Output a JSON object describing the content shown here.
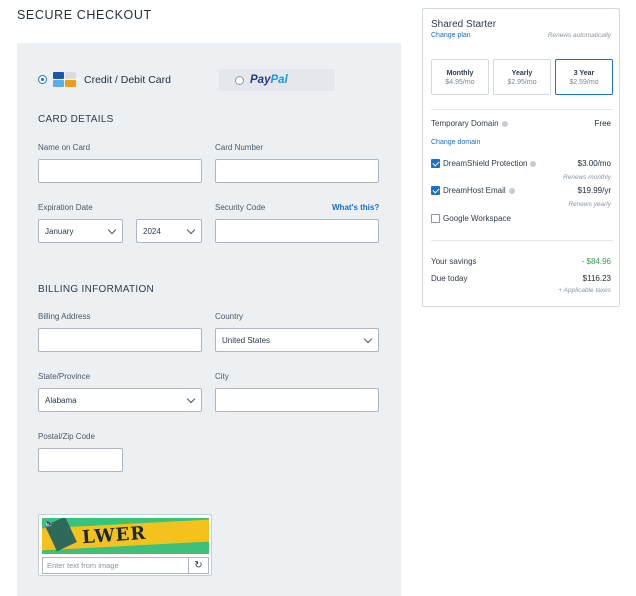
{
  "page": {
    "title": "SECURE CHECKOUT"
  },
  "payment": {
    "credit_label": "Credit / Debit Card",
    "paypal_pay": "Pay",
    "paypal_pal": "Pal",
    "selected": "credit"
  },
  "card_details": {
    "heading": "CARD DETAILS",
    "name_label": "Name on Card",
    "name_value": "",
    "number_label": "Card Number",
    "number_value": "",
    "expiration_label": "Expiration Date",
    "month_value": "January",
    "year_value": "2024",
    "security_label": "Security Code",
    "whats_this": "What's this?",
    "security_value": ""
  },
  "billing": {
    "heading": "BILLING INFORMATION",
    "address_label": "Billing Address",
    "address_value": "",
    "country_label": "Country",
    "country_value": "United States",
    "state_label": "State/Province",
    "state_value": "Alabama",
    "city_label": "City",
    "city_value": "",
    "zip_label": "Postal/Zip Code",
    "zip_value": ""
  },
  "captcha": {
    "image_text": "LWER",
    "placeholder": "Enter text from image"
  },
  "summary": {
    "plan": "Shared Starter",
    "change_plan": "Change plan",
    "renews": "Renews automatically",
    "terms": [
      {
        "name": "Monthly",
        "price": "$4.95/mo",
        "selected": false
      },
      {
        "name": "Yearly",
        "price": "$2.95/mo",
        "selected": false
      },
      {
        "name": "3 Year",
        "price": "$2.59/mo",
        "selected": true
      }
    ],
    "domain_label": "Temporary Domain",
    "domain_value": "Free",
    "change_domain": "Change domain",
    "addons": [
      {
        "label": "DreamShield Protection",
        "price": "$3.00/mo",
        "note": "Renews monthly",
        "checked": true
      },
      {
        "label": "DreamHost Email",
        "price": "$19.99/yr",
        "note": "Renews yearly",
        "checked": true
      },
      {
        "label": "Google Workspace",
        "price": "",
        "note": "",
        "checked": false
      }
    ],
    "savings_label": "Your savings",
    "savings_value": "- $84.96",
    "due_label": "Due today",
    "due_value": "$116.23",
    "taxes_note": "+ Applicable taxes"
  },
  "colors": {
    "accent": "#1a73c8",
    "savings": "#2e9e4f",
    "panel": "#edf0f3"
  }
}
